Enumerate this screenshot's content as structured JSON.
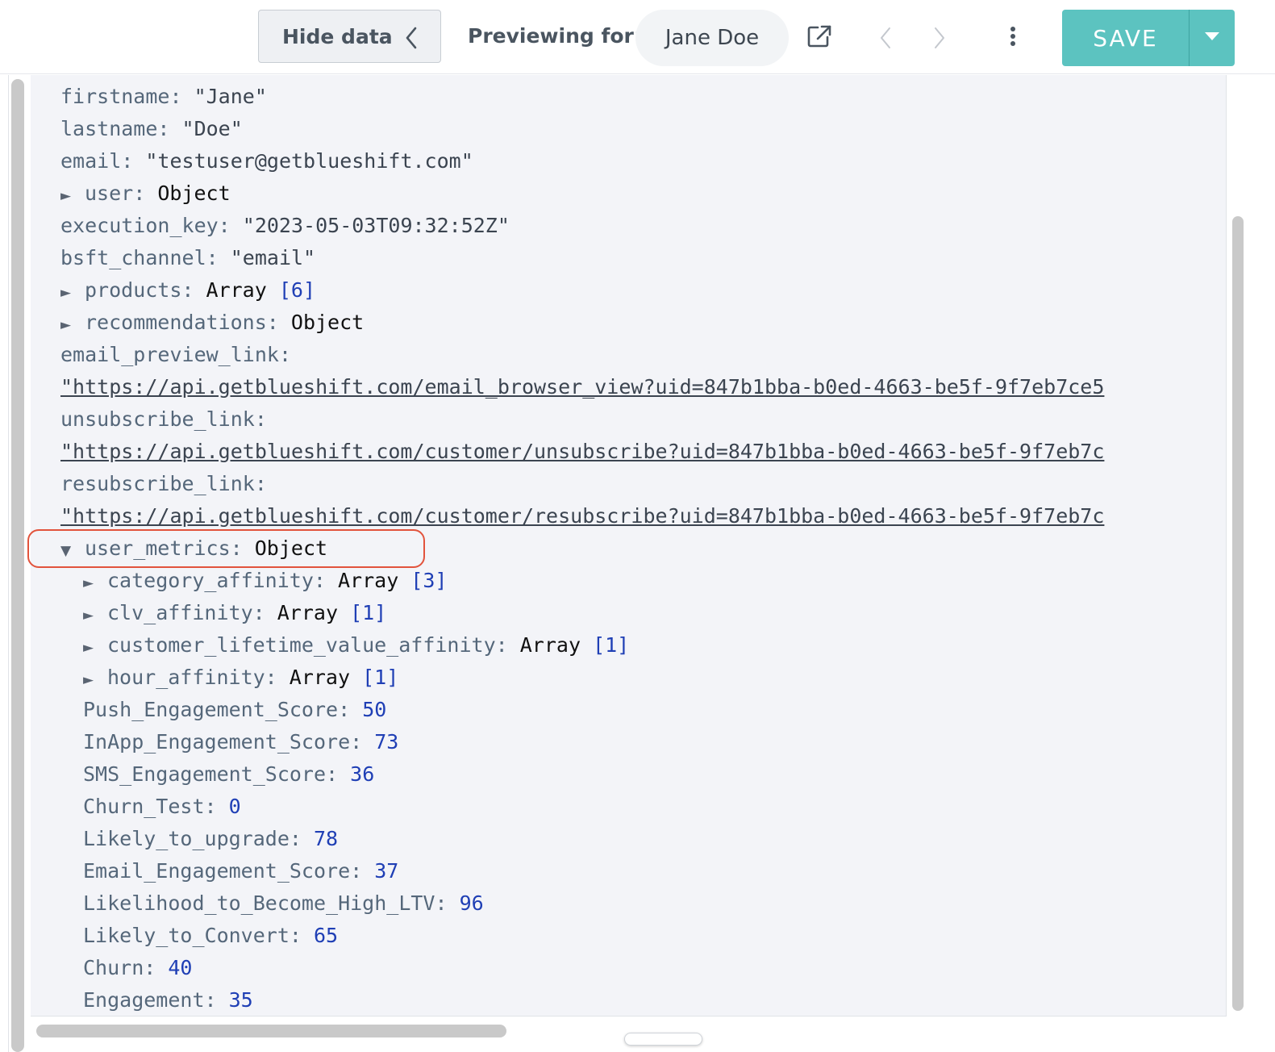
{
  "toolbar": {
    "hide_data_label": "Hide data",
    "previewing_label": "Previewing for:",
    "preview_user": "Jane Doe",
    "save_label": "SAVE",
    "icons": {
      "hide_chevron": "chevron-left-icon",
      "external": "external-link-icon",
      "prev": "chevron-left-icon",
      "next": "chevron-right-icon",
      "more": "more-vertical-icon",
      "save_menu": "caret-down-icon"
    },
    "colors": {
      "save": "#5cc3c0",
      "highlight": "#e2533c"
    }
  },
  "tree": {
    "rows": [
      {
        "key": "firstname",
        "sep": ": ",
        "value": "\"Jane\"",
        "type": "string"
      },
      {
        "key": "lastname",
        "sep": ": ",
        "value": "\"Doe\"",
        "type": "string"
      },
      {
        "key": "email",
        "sep": ": ",
        "value": "\"testuser@getblueshift.com\"",
        "type": "string"
      },
      {
        "key": "user",
        "sep": ": ",
        "value": "Object",
        "type": "object",
        "toggle": "►"
      },
      {
        "key": "execution_key",
        "sep": ": ",
        "value": "\"2023-05-03T09:32:52Z\"",
        "type": "string"
      },
      {
        "key": "bsft_channel",
        "sep": ": ",
        "value": "\"email\"",
        "type": "string"
      },
      {
        "key": "products",
        "sep": ": ",
        "value": "Array",
        "count": "[6]",
        "type": "array",
        "toggle": "►"
      },
      {
        "key": "recommendations",
        "sep": ": ",
        "value": "Object",
        "type": "object",
        "toggle": "►"
      },
      {
        "key": "email_preview_link",
        "sep": ":",
        "type": "label"
      },
      {
        "value": "\"https://api.getblueshift.com/email_browser_view?uid=847b1bba-b0ed-4663-be5f-9f7eb7ce5",
        "type": "link"
      },
      {
        "key": "unsubscribe_link",
        "sep": ":",
        "type": "label"
      },
      {
        "value": "\"https://api.getblueshift.com/customer/unsubscribe?uid=847b1bba-b0ed-4663-be5f-9f7eb7c",
        "type": "link"
      },
      {
        "key": "resubscribe_link",
        "sep": ":",
        "type": "label"
      },
      {
        "value": "\"https://api.getblueshift.com/customer/resubscribe?uid=847b1bba-b0ed-4663-be5f-9f7eb7c",
        "type": "link"
      },
      {
        "key": "user_metrics",
        "sep": ": ",
        "value": "Object",
        "type": "object",
        "toggle": "▼"
      },
      {
        "key": "category_affinity",
        "sep": ": ",
        "value": "Array",
        "count": "[3]",
        "type": "array",
        "toggle": "►",
        "indent": 1
      },
      {
        "key": "clv_affinity",
        "sep": ": ",
        "value": "Array",
        "count": "[1]",
        "type": "array",
        "toggle": "►",
        "indent": 1
      },
      {
        "key": "customer_lifetime_value_affinity",
        "sep": ": ",
        "value": "Array",
        "count": "[1]",
        "type": "array",
        "toggle": "►",
        "indent": 1
      },
      {
        "key": "hour_affinity",
        "sep": ": ",
        "value": "Array",
        "count": "[1]",
        "type": "array",
        "toggle": "►",
        "indent": 1
      },
      {
        "key": "Push_Engagement_Score",
        "sep": ": ",
        "value": "50",
        "type": "number",
        "indent": 1
      },
      {
        "key": "InApp_Engagement_Score",
        "sep": ": ",
        "value": "73",
        "type": "number",
        "indent": 1
      },
      {
        "key": "SMS_Engagement_Score",
        "sep": ": ",
        "value": "36",
        "type": "number",
        "indent": 1
      },
      {
        "key": "Churn_Test",
        "sep": ": ",
        "value": "0",
        "type": "number",
        "indent": 1
      },
      {
        "key": "Likely_to_upgrade",
        "sep": ": ",
        "value": "78",
        "type": "number",
        "indent": 1
      },
      {
        "key": "Email_Engagement_Score",
        "sep": ": ",
        "value": "37",
        "type": "number",
        "indent": 1
      },
      {
        "key": "Likelihood_to_Become_High_LTV",
        "sep": ": ",
        "value": "96",
        "type": "number",
        "indent": 1
      },
      {
        "key": "Likely_to_Convert",
        "sep": ": ",
        "value": "65",
        "type": "number",
        "indent": 1
      },
      {
        "key": "Churn",
        "sep": ": ",
        "value": "40",
        "type": "number",
        "indent": 1
      },
      {
        "key": "Engagement",
        "sep": ": ",
        "value": "35",
        "type": "number",
        "indent": 1
      }
    ]
  }
}
